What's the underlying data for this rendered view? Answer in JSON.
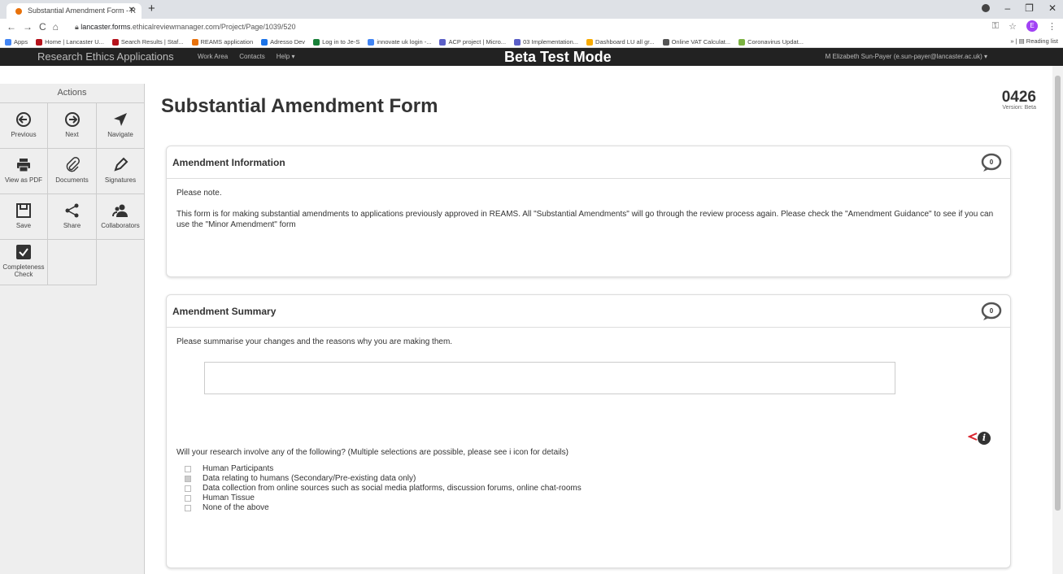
{
  "browser": {
    "tab_title": "Substantial Amendment Form - R",
    "url_host": "lancaster.forms",
    "url_rest": ".ethicalreviewmanager.com/Project/Page/1039/520",
    "profile_initial": "E",
    "bookmarks": [
      {
        "label": "Apps",
        "color": "#4285f4"
      },
      {
        "label": "Home | Lancaster U...",
        "color": "#b5121b"
      },
      {
        "label": "Search Results | Staf...",
        "color": "#b5121b"
      },
      {
        "label": "REAMS application",
        "color": "#e8710a"
      },
      {
        "label": "Adresso Dev",
        "color": "#1a73e8"
      },
      {
        "label": "Log in to Je-S",
        "color": "#188038"
      },
      {
        "label": "innovate uk login -...",
        "color": "#4285f4"
      },
      {
        "label": "ACP project | Micro...",
        "color": "#5b5fc7"
      },
      {
        "label": "03 Implementation...",
        "color": "#5b5fc7"
      },
      {
        "label": "Dashboard LU all gr...",
        "color": "#f9ab00"
      },
      {
        "label": "Online VAT Calculat...",
        "color": "#555555"
      },
      {
        "label": "Coronavirus Updat...",
        "color": "#7cb342"
      }
    ],
    "reading_list": "Reading list"
  },
  "appnav": {
    "brand": "Research Ethics Applications",
    "links": [
      "Work Area",
      "Contacts",
      "Help ▾"
    ],
    "mode": "Beta Test Mode",
    "user": "M Elizabeth Sun-Payer (e.sun-payer@lancaster.ac.uk) ▾"
  },
  "sidebar": {
    "title": "Actions",
    "items": [
      {
        "label": "Previous",
        "icon": "previous-icon"
      },
      {
        "label": "Next",
        "icon": "next-icon"
      },
      {
        "label": "Navigate",
        "icon": "navigate-icon"
      },
      {
        "label": "View as PDF",
        "icon": "print-icon"
      },
      {
        "label": "Documents",
        "icon": "paperclip-icon"
      },
      {
        "label": "Signatures",
        "icon": "pen-icon"
      },
      {
        "label": "Save",
        "icon": "save-icon"
      },
      {
        "label": "Share",
        "icon": "share-icon"
      },
      {
        "label": "Collaborators",
        "icon": "collaborators-icon"
      },
      {
        "label": "Completeness Check",
        "icon": "check-icon"
      }
    ]
  },
  "main": {
    "title": "Substantial Amendment Form",
    "version_number": "0426",
    "version_label": "Version: Beta",
    "info_panel": {
      "heading": "Amendment Information",
      "comment_count": "0",
      "note": "Please note.",
      "body": "This form is for making substantial amendments to applications previously approved in REAMS. All \"Substantial Amendments\" will go through the review process again. Please check the \"Amendment Guidance\" to see if you can use the \"Minor Amendment\" form"
    },
    "summary_panel": {
      "heading": "Amendment Summary",
      "comment_count": "0",
      "prompt": "Please summarise your changes and the reasons why you are making them.",
      "summary_value": "",
      "question": "Will your research involve any of the following? (Multiple selections are possible, please see i icon for details)",
      "options": [
        {
          "label": "Human Participants",
          "checked": false
        },
        {
          "label": "Data relating to humans (Secondary/Pre-existing data only)",
          "checked": true
        },
        {
          "label": "Data collection from online sources such as social media platforms, discussion forums, online chat-rooms",
          "checked": false
        },
        {
          "label": "Human Tissue",
          "checked": false
        },
        {
          "label": "None of the above",
          "checked": false
        }
      ]
    }
  }
}
